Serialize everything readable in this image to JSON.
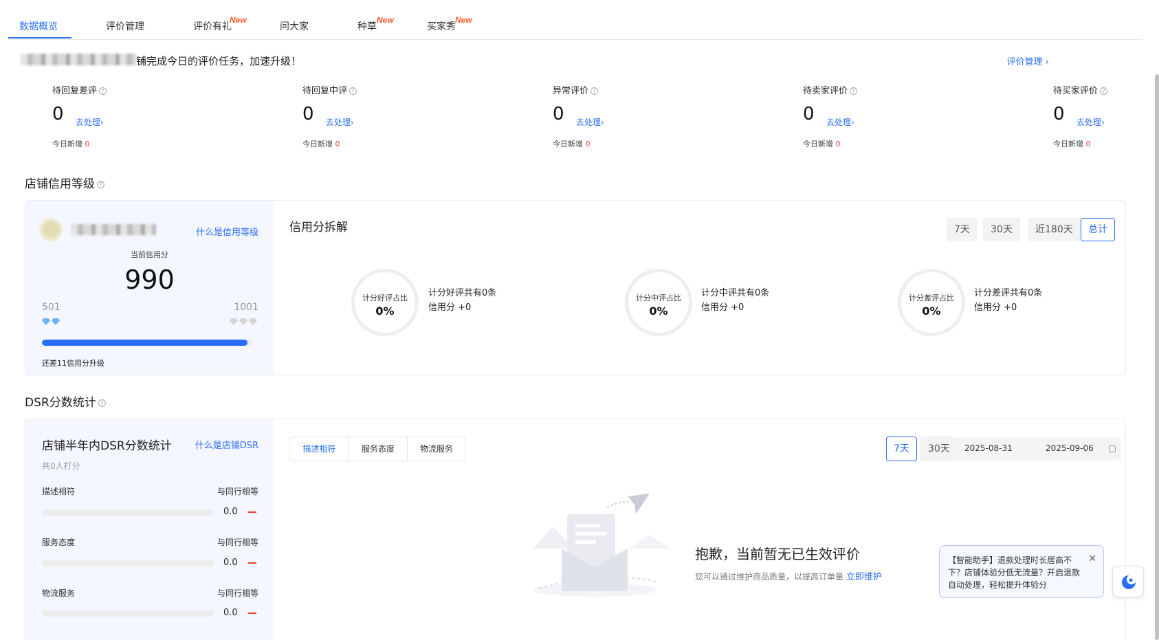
{
  "tabs": [
    {
      "label": "数据概览",
      "active": true,
      "new": false
    },
    {
      "label": "评价管理",
      "active": false,
      "new": false
    },
    {
      "label": "评价有礼",
      "active": false,
      "new": true
    },
    {
      "label": "问大家",
      "active": false,
      "new": false
    },
    {
      "label": "种草",
      "active": false,
      "new": true
    },
    {
      "label": "买家秀",
      "active": false,
      "new": true
    }
  ],
  "new_badge": "New",
  "notice": {
    "text": "铺完成今日的评价任务，加速升级！",
    "link": "评价管理 ›"
  },
  "stats": [
    {
      "title": "待回复差评",
      "count": "0",
      "action": "去处理›",
      "sub_label": "今日新增",
      "sub_value": "0"
    },
    {
      "title": "待回复中评",
      "count": "0",
      "action": "去处理›",
      "sub_label": "今日新增",
      "sub_value": "0"
    },
    {
      "title": "异常评价",
      "count": "0",
      "action": "去处理›",
      "sub_label": "今日新增",
      "sub_value": "0"
    },
    {
      "title": "待卖家评价",
      "count": "0",
      "action": "去处理›",
      "sub_label": "今日新增",
      "sub_value": "0"
    },
    {
      "title": "待买家评价",
      "count": "0",
      "action": "去处理›",
      "sub_label": "今日新增",
      "sub_value": "0"
    }
  ],
  "credit": {
    "section_title": "店铺信用等级",
    "what_link": "什么是信用等级",
    "current_label": "当前信用分",
    "score": "990",
    "min": "501",
    "max": "1001",
    "progress": 0.98,
    "remaining_text": "还差11信用分升级",
    "breakdown_title": "信用分拆解",
    "periods": [
      {
        "label": "7天",
        "active": false
      },
      {
        "label": "30天",
        "active": false
      },
      {
        "label": "近180天",
        "active": false
      },
      {
        "label": "总计",
        "active": true
      }
    ],
    "rings": [
      {
        "label": "计分好评占比",
        "value": "0%",
        "line1": "计分好评共有0条",
        "line2": "信用分 +0"
      },
      {
        "label": "计分中评占比",
        "value": "0%",
        "line1": "计分中评共有0条",
        "line2": "信用分 +0"
      },
      {
        "label": "计分差评占比",
        "value": "0%",
        "line1": "计分差评共有0条",
        "line2": "信用分 +0"
      }
    ]
  },
  "dsr": {
    "section_title": "DSR分数统计",
    "panel_title": "店铺半年内DSR分数统计",
    "what_link": "什么是店铺DSR",
    "count_text": "共0人打分",
    "rows": [
      {
        "label": "描述相符",
        "compare": "与同行相等",
        "value": "0.0"
      },
      {
        "label": "服务态度",
        "compare": "与同行相等",
        "value": "0.0"
      },
      {
        "label": "物流服务",
        "compare": "与同行相等",
        "value": "0.0"
      }
    ],
    "segments": [
      {
        "label": "描述相符",
        "active": true
      },
      {
        "label": "服务态度",
        "active": false
      },
      {
        "label": "物流服务",
        "active": false
      }
    ],
    "periods": [
      {
        "label": "7天",
        "active": true
      },
      {
        "label": "30天",
        "active": false
      }
    ],
    "date_start": "2025-08-31",
    "date_end": "2025-09-06",
    "empty_title": "抱歉，当前暂无已生效评价",
    "empty_sub": "您可以通过维护商品质量，以提高订单量",
    "empty_link": "立即维护"
  },
  "toast": {
    "text": "【智能助手】退款处理时长居高不下？店铺体验分低无流量？开启退款自动处理，轻松提升体验分",
    "close": "✕"
  },
  "colors": {
    "accent": "#2a6ef7",
    "new_badge": "#ff5a2b",
    "alert": "#ff3b30",
    "panel_bg": "#f4f7ff"
  }
}
